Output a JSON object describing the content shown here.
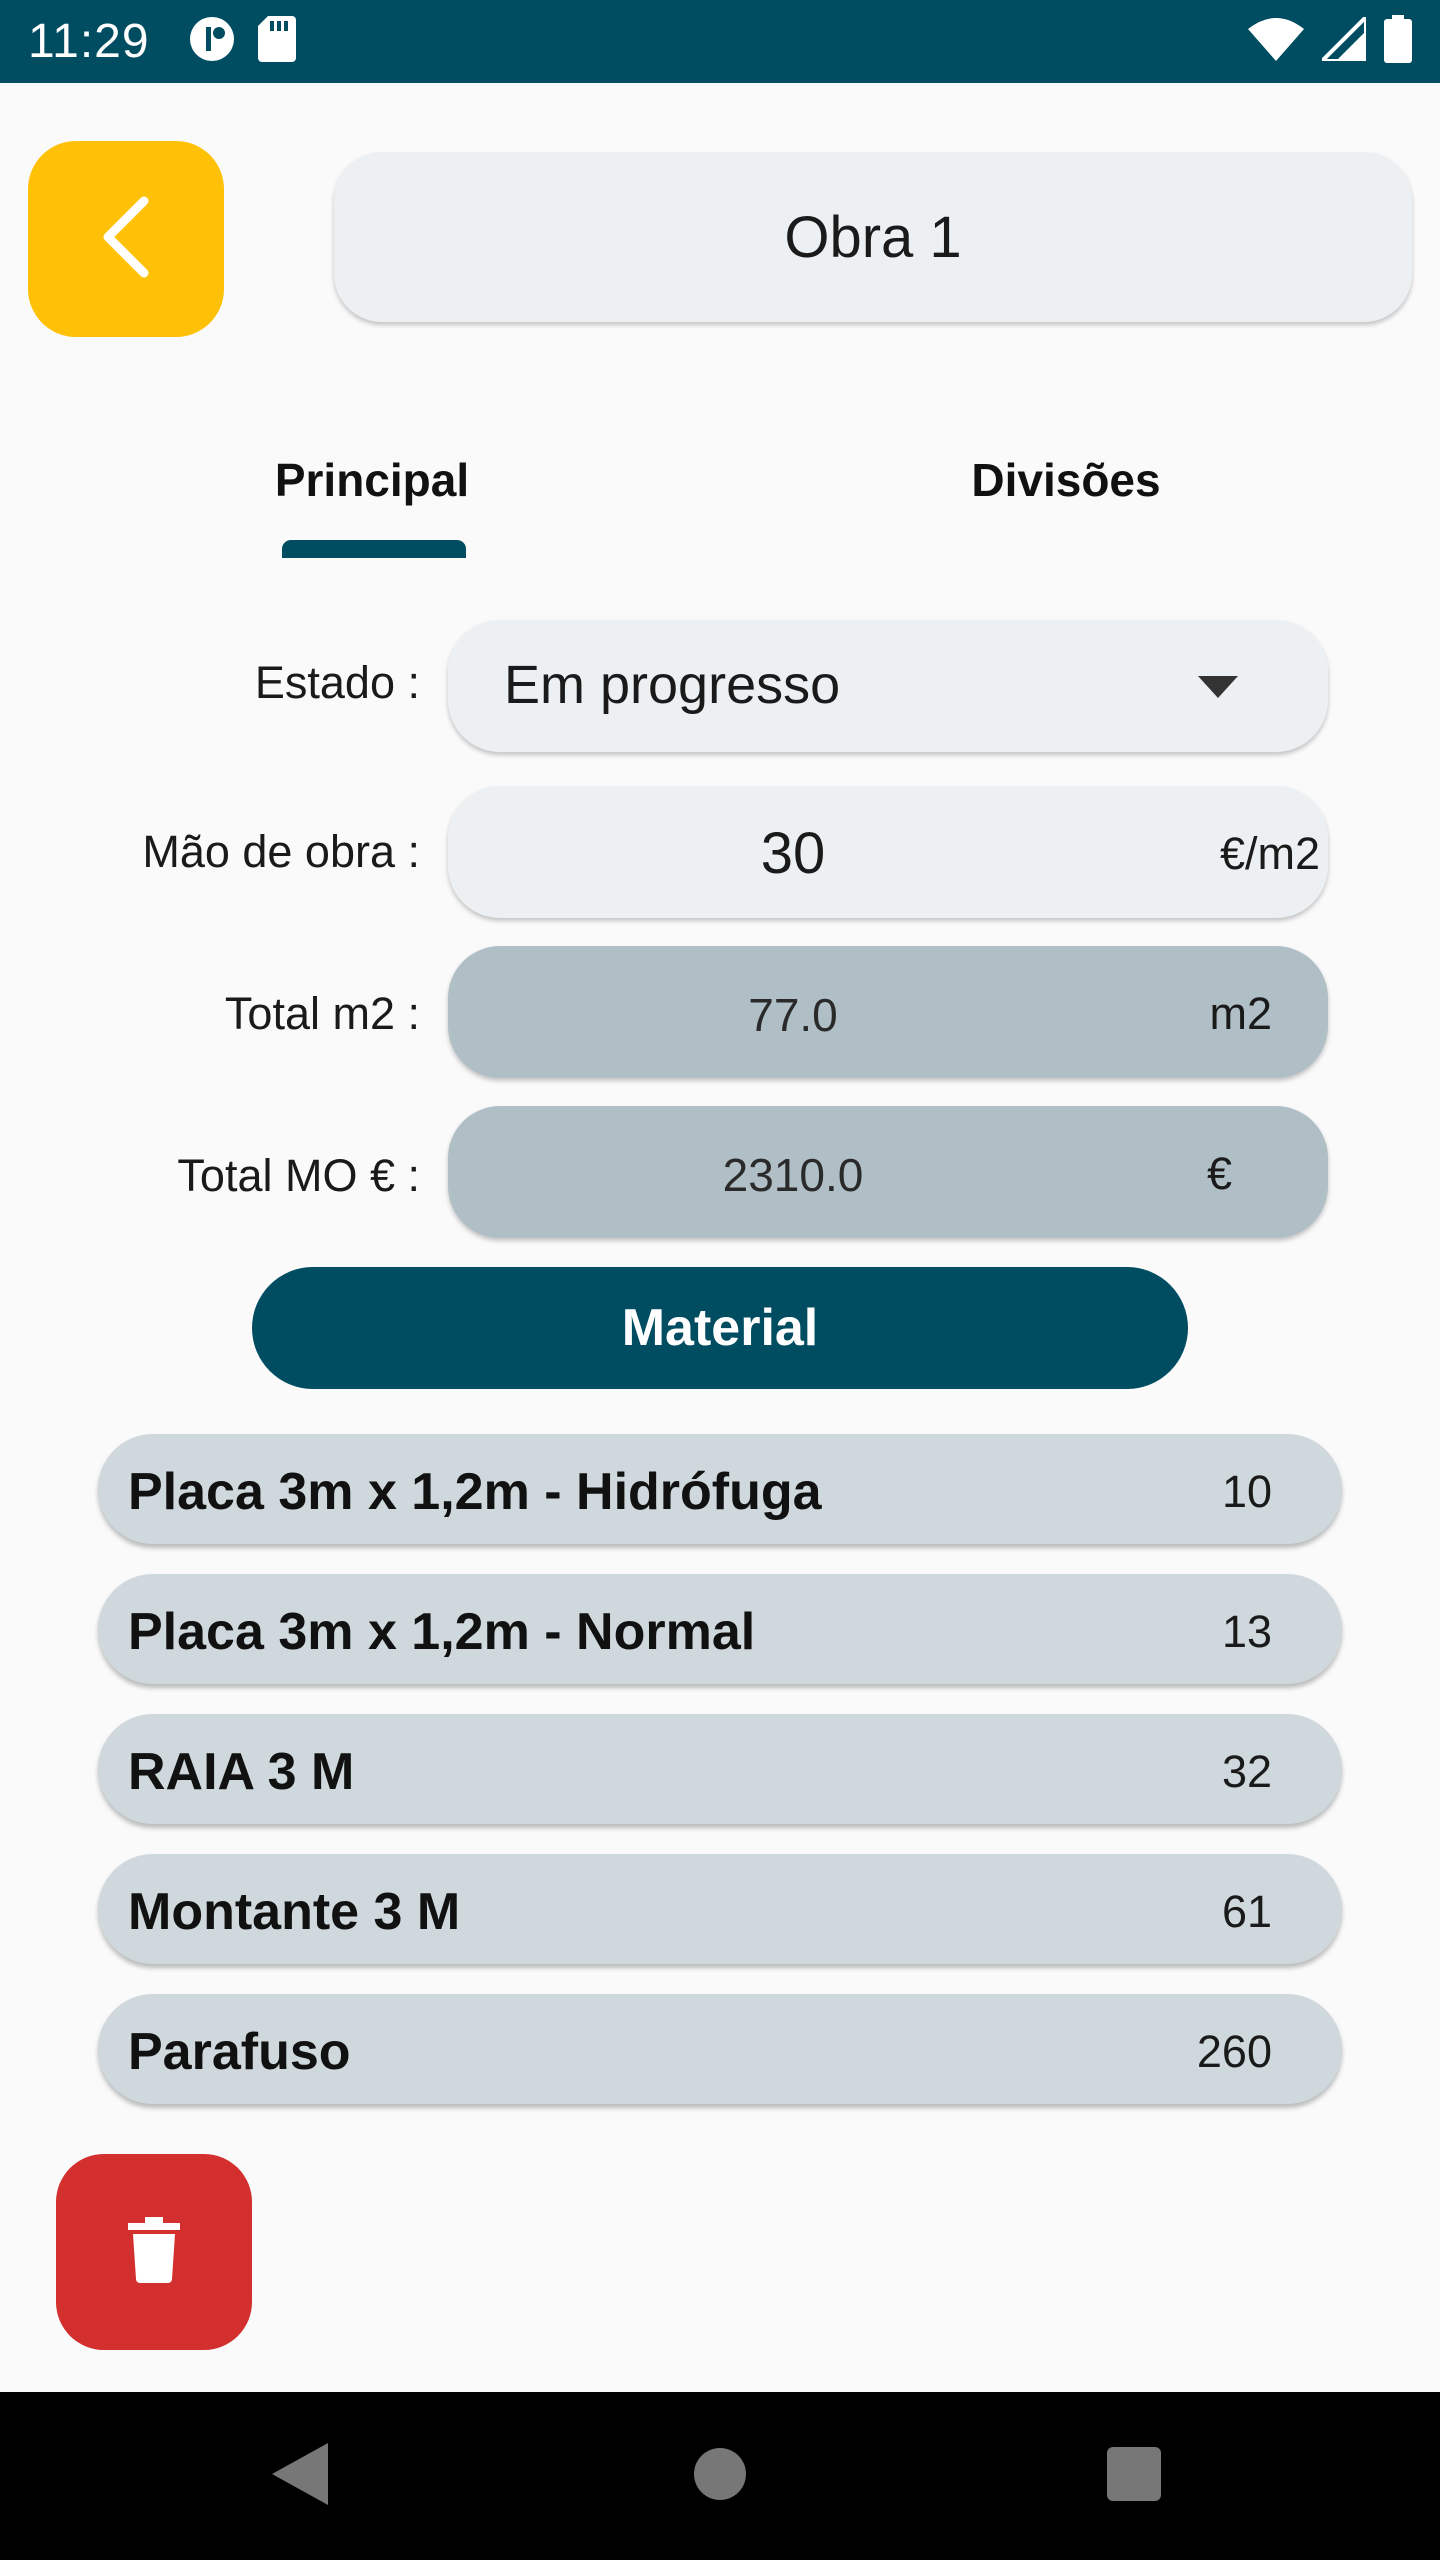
{
  "status_bar": {
    "time": "11:29"
  },
  "header": {
    "title": "Obra 1",
    "back_icon": "chevron-left-icon"
  },
  "tabs": [
    {
      "label": "Principal",
      "selected": true
    },
    {
      "label": "Divisões",
      "selected": false
    }
  ],
  "form": {
    "estado": {
      "label": "Estado :",
      "value": "Em progresso"
    },
    "mao_de_obra": {
      "label": "Mão de obra :",
      "value": "30",
      "unit": "€/m2"
    },
    "total_m2": {
      "label": "Total m2 :",
      "value": "77.0",
      "unit": "m2"
    },
    "total_mo": {
      "label": "Total MO € :",
      "value": "2310.0",
      "unit": "€"
    }
  },
  "material_button": {
    "label": "Material"
  },
  "materials": [
    {
      "name": "Placa 3m x 1,2m - Hidrófuga",
      "qty": "10"
    },
    {
      "name": "Placa 3m x 1,2m - Normal",
      "qty": "13"
    },
    {
      "name": "RAIA 3 M",
      "qty": "32"
    },
    {
      "name": "Montante 3 M",
      "qty": "61"
    },
    {
      "name": "Parafuso",
      "qty": "260"
    }
  ],
  "colors": {
    "status_bar": "#004d61",
    "back_button": "#ffc107",
    "primary": "#004d61",
    "delete_button": "#d32f2f",
    "readonly_field": "#b0bec5",
    "list_item": "#cfd8dc"
  }
}
